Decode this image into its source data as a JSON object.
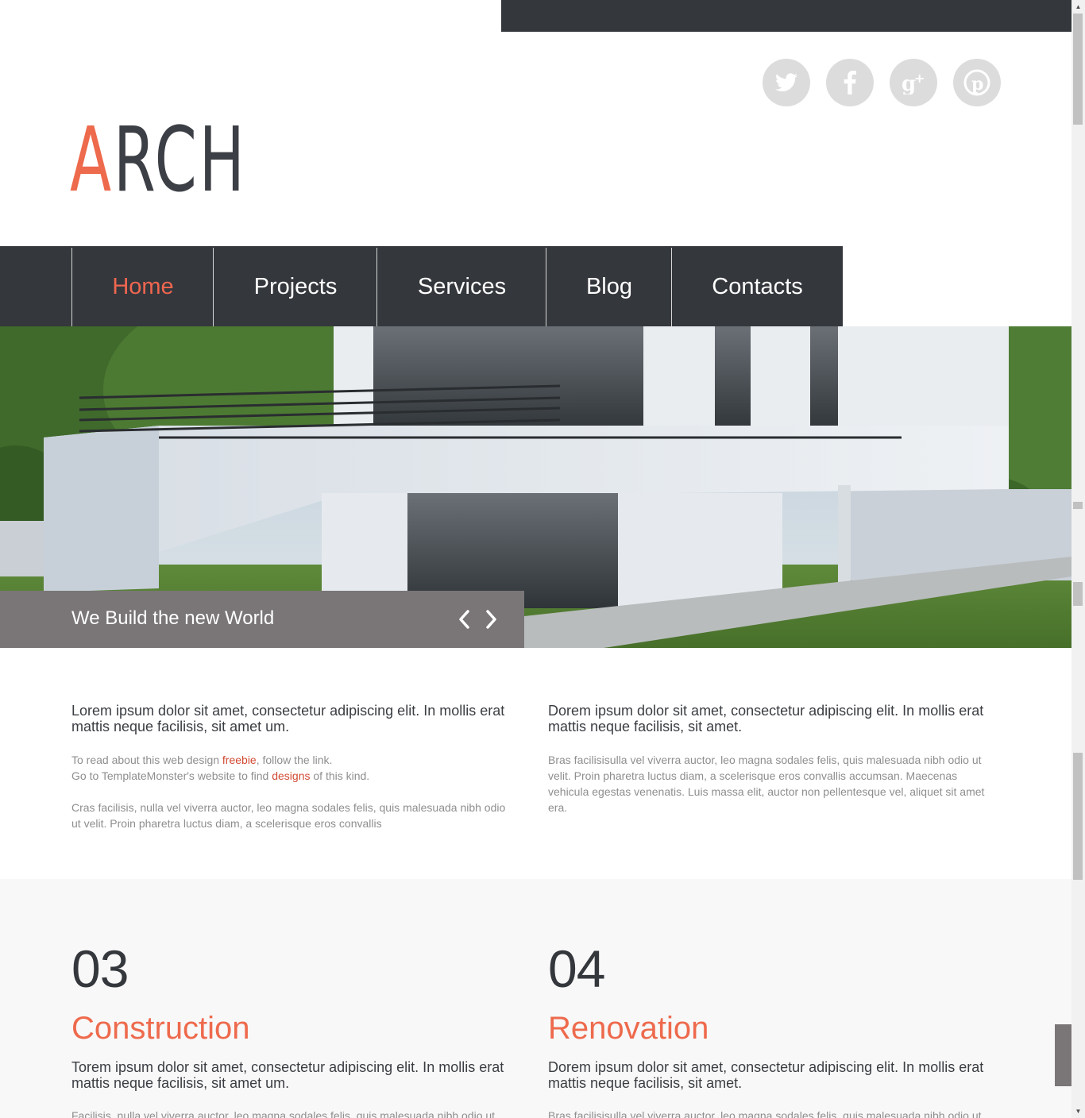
{
  "logo": {
    "first": "A",
    "rest": "RCH"
  },
  "social": [
    "twitter-icon",
    "facebook-icon",
    "google-plus-icon",
    "pinterest-icon"
  ],
  "nav": [
    {
      "label": "Home",
      "active": true
    },
    {
      "label": "Projects"
    },
    {
      "label": "Services"
    },
    {
      "label": "Blog"
    },
    {
      "label": "Contacts"
    }
  ],
  "hero": {
    "caption": "We Build the new World"
  },
  "intro": {
    "left": {
      "lead": "Lorem ipsum dolor sit amet, consectetur adipiscing elit. In mollis erat mattis neque facilisis, sit amet um.",
      "line1_before": "To read about this web design ",
      "line1_link": "freebie",
      "line1_after": ", follow the link.",
      "line2_before": "Go to TemplateMonster's website to find ",
      "line2_link": "designs",
      "line2_after": " of this kind.",
      "body": "Cras facilisis, nulla vel viverra auctor, leo magna sodales felis, quis malesuada nibh odio ut velit. Proin pharetra luctus diam, a scelerisque eros convallis"
    },
    "right": {
      "lead": "Dorem ipsum dolor sit amet, consectetur adipiscing elit. In mollis erat mattis neque facilisis, sit amet.",
      "body": "Bras facilisisulla vel viverra auctor, leo magna sodales felis, quis malesuada nibh odio ut velit. Proin pharetra luctus diam, a scelerisque eros convallis accumsan. Maecenas vehicula egestas venenatis. Luis massa elit, auctor non pellentesque vel, aliquet sit amet era."
    }
  },
  "services": [
    {
      "number": "03",
      "title": "Construction",
      "lead": "Torem ipsum dolor sit amet, consectetur adipiscing elit. In mollis erat mattis neque facilisis, sit amet um.",
      "body": "Facilisis, nulla vel viverra auctor, leo magna sodales felis, quis malesuada nibh odio ut"
    },
    {
      "number": "04",
      "title": "Renovation",
      "lead": "Dorem ipsum dolor sit amet, consectetur adipiscing elit. In mollis erat mattis neque facilisis, sit amet.",
      "body": "Bras facilisisulla vel viverra auctor, leo magna sodales felis, quis malesuada nibh odio ut"
    }
  ],
  "colors": {
    "accent": "#ee6a4d",
    "dark": "#34373c",
    "caption_bg": "#7a7677",
    "social_bg": "#dcdcdc"
  }
}
